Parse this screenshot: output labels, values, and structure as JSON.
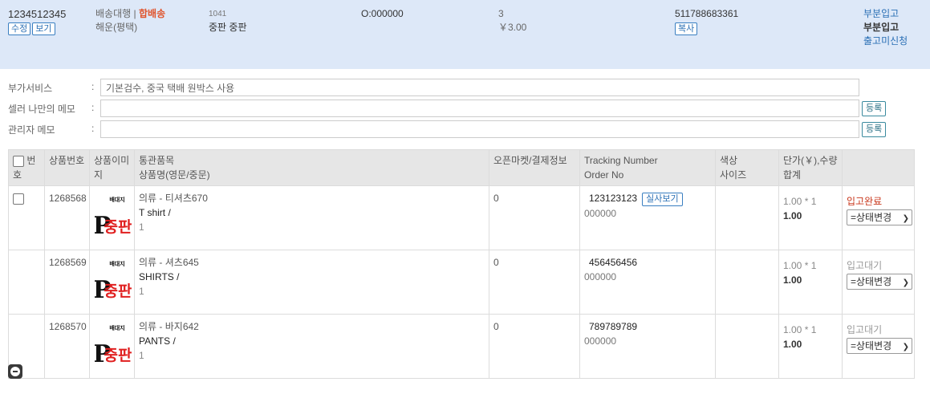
{
  "summary": {
    "order_no": "1234512345",
    "edit_label": "수정",
    "view_label": "보기",
    "delivery_type": "배송대행",
    "separator": "|",
    "combined": "합배송",
    "shipping_method": "해운(평택)",
    "center_code": "1041",
    "center_name": "중판 중판",
    "o_code": "O:000000",
    "qty": "3",
    "amount": "￥3.00",
    "tracking": "511788683361",
    "copy_label": "복사",
    "status_link": "부분입고",
    "status_text": "부분입고",
    "release_link": "출고미신청"
  },
  "memo": {
    "service_label": "부가서비스",
    "service_value": "기본검수, 중국 택배 원박스 사용",
    "seller_label": "셀러 나만의 메모",
    "seller_value": "",
    "admin_label": "관리자 메모",
    "admin_value": "",
    "colon": ":",
    "register_label": "등록"
  },
  "table": {
    "headers": {
      "no_line1": "번",
      "no_line2": "호",
      "product_no": "상품번호",
      "image": "상품이미지",
      "customs": "통관품목",
      "product_name": "상품명(영문/중문)",
      "open_market": "오픈마켓/결제정보",
      "tracking": "Tracking Number",
      "order_no": "Order No",
      "color": "색상",
      "size": "사이즈",
      "price": "단가(￥),수량",
      "total": "합계"
    },
    "rows": [
      {
        "product_no": "1268568",
        "customs": "의류 - 티셔츠670",
        "name": "T shirt /",
        "qty": "1",
        "open_market": "0",
        "tracking": "123123123",
        "has_view": true,
        "view_label": "실사보기",
        "order_no": "000000",
        "price": "1.00 * 1",
        "total": "1.00",
        "status": "입고완료",
        "select": "=상태변경"
      },
      {
        "product_no": "1268569",
        "customs": "의류 - 셔츠645",
        "name": "SHIRTS /",
        "qty": "1",
        "open_market": "0",
        "tracking": "456456456",
        "has_view": false,
        "order_no": "000000",
        "price": "1.00 * 1",
        "total": "1.00",
        "status": "입고대기",
        "select": "=상태변경"
      },
      {
        "product_no": "1268570",
        "customs": "의류 - 바지642",
        "name": "PANTS /",
        "qty": "1",
        "open_market": "0",
        "tracking": "789789789",
        "has_view": false,
        "order_no": "000000",
        "price": "1.00 * 1",
        "total": "1.00",
        "status": "입고대기",
        "select": "=상태변경"
      }
    ]
  },
  "logo": {
    "top_text": "배대지",
    "main_text": "중판",
    "letter": "P",
    "red": "#e02020",
    "black": "#111111"
  }
}
